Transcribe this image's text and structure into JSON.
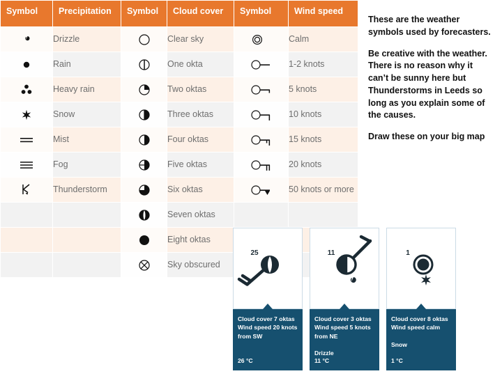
{
  "table": {
    "headers": [
      "Symbol",
      "Precipitation",
      "Symbol",
      "Cloud cover",
      "Symbol",
      "Wind speed"
    ],
    "header_bg": "#e8782d",
    "rows": [
      {
        "precip_symbol": "drizzle-comma",
        "precip": "Drizzle",
        "cloud_symbol": "okta-0",
        "cloud": "Clear sky",
        "wind_symbol": "wind-calm",
        "wind": "Calm"
      },
      {
        "precip_symbol": "rain-dot",
        "precip": "Rain",
        "cloud_symbol": "okta-1",
        "cloud": "One okta",
        "wind_symbol": "wind-1-2",
        "wind": "1-2 knots"
      },
      {
        "precip_symbol": "heavy-rain-3dots",
        "precip": "Heavy rain",
        "cloud_symbol": "okta-2",
        "cloud": "Two oktas",
        "wind_symbol": "wind-5",
        "wind": "5 knots"
      },
      {
        "precip_symbol": "snow-star",
        "precip": "Snow",
        "cloud_symbol": "okta-3",
        "cloud": "Three oktas",
        "wind_symbol": "wind-10",
        "wind": "10 knots"
      },
      {
        "precip_symbol": "mist-2lines",
        "precip": "Mist",
        "cloud_symbol": "okta-4",
        "cloud": "Four oktas",
        "wind_symbol": "wind-15",
        "wind": "15 knots"
      },
      {
        "precip_symbol": "fog-3lines",
        "precip": "Fog",
        "cloud_symbol": "okta-5",
        "cloud": "Five oktas",
        "wind_symbol": "wind-20",
        "wind": "20 knots"
      },
      {
        "precip_symbol": "thunderstorm-k",
        "precip": "Thunderstorm",
        "cloud_symbol": "okta-6",
        "cloud": "Six oktas",
        "wind_symbol": "wind-50",
        "wind": "50 knots or more"
      },
      {
        "precip_symbol": "",
        "precip": "",
        "cloud_symbol": "okta-7",
        "cloud": "Seven oktas",
        "wind_symbol": "",
        "wind": ""
      },
      {
        "precip_symbol": "",
        "precip": "",
        "cloud_symbol": "okta-8",
        "cloud": "Eight oktas",
        "wind_symbol": "",
        "wind": ""
      },
      {
        "precip_symbol": "",
        "precip": "",
        "cloud_symbol": "sky-obscured",
        "cloud": "Sky obscured",
        "wind_symbol": "",
        "wind": ""
      }
    ]
  },
  "notes": {
    "paragraphs": [
      "These are the weather symbols used by forecasters.",
      "Be creative with the weather. There is no reason why it can’t be sunny here but Thunderstorms in Leeds so long as you explain some of the causes.",
      "Draw these on your big map"
    ]
  },
  "cards": [
    {
      "number": "25",
      "cloud_symbol": "okta-7",
      "wind_symbol": "wind-20-from-sw",
      "precip_symbol": "",
      "cloud_line": "Cloud cover 7 oktas",
      "wind_line": "Wind speed 20 knots",
      "wind_line2": "from SW",
      "precip_line": "",
      "temperature": "26 °C"
    },
    {
      "number": "11",
      "cloud_symbol": "okta-3",
      "wind_symbol": "wind-5-from-ne",
      "precip_symbol": "drizzle-comma",
      "cloud_line": "Cloud cover 3 oktas",
      "wind_line": "Wind speed 5 knots",
      "wind_line2": "from NE",
      "precip_line": "Drizzle",
      "temperature": "11 °C"
    },
    {
      "number": "1",
      "cloud_symbol": "okta-8",
      "wind_symbol": "wind-calm",
      "precip_symbol": "snow-star",
      "cloud_line": "Cloud cover 8 oktas",
      "wind_line": "Wind speed calm",
      "wind_line2": "",
      "precip_line": "Snow",
      "temperature": "1 °C"
    }
  ],
  "colors": {
    "header_orange": "#e8782d",
    "row_peach": "#fdf0e6",
    "row_gray": "#f2f2f2",
    "card_blue": "#16506f",
    "text_gray": "#6e6e6e"
  }
}
